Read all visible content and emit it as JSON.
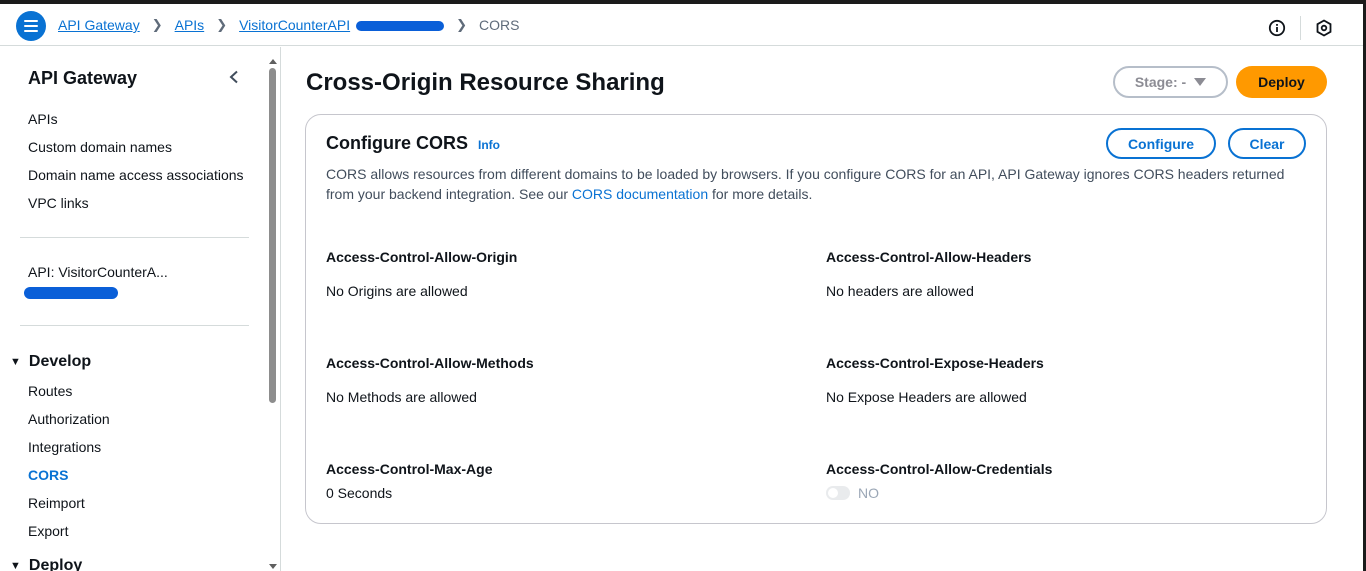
{
  "breadcrumb": {
    "items": [
      "API Gateway",
      "APIs",
      "VisitorCounterAPI"
    ],
    "current": "CORS"
  },
  "sidebar": {
    "title": "API Gateway",
    "links": [
      "APIs",
      "Custom domain names",
      "Domain name access associations",
      "VPC links"
    ],
    "api_label": "API: VisitorCounterA...",
    "develop": {
      "heading": "Develop",
      "items": [
        "Routes",
        "Authorization",
        "Integrations",
        "CORS",
        "Reimport",
        "Export"
      ],
      "active": "CORS"
    },
    "deploy_heading": "Deploy"
  },
  "page": {
    "title": "Cross-Origin Resource Sharing",
    "stage_label": "Stage: -",
    "deploy_label": "Deploy"
  },
  "card": {
    "title": "Configure CORS",
    "info": "Info",
    "configure_label": "Configure",
    "clear_label": "Clear",
    "desc_before": "CORS allows resources from different domains to be loaded by browsers. If you configure CORS for an API, API Gateway ignores CORS headers returned from your backend integration. See our ",
    "desc_link": "CORS documentation",
    "desc_after": " for more details.",
    "fields": [
      {
        "label": "Access-Control-Allow-Origin",
        "value": "No Origins are allowed"
      },
      {
        "label": "Access-Control-Allow-Headers",
        "value": "No headers are allowed"
      },
      {
        "label": "Access-Control-Allow-Methods",
        "value": "No Methods are allowed"
      },
      {
        "label": "Access-Control-Expose-Headers",
        "value": "No Expose Headers are allowed"
      },
      {
        "label": "Access-Control-Max-Age",
        "value": "0 Seconds"
      },
      {
        "label": "Access-Control-Allow-Credentials",
        "value": "NO"
      }
    ]
  },
  "colors": {
    "accent": "#0972d3",
    "deploy": "#ff9900"
  }
}
